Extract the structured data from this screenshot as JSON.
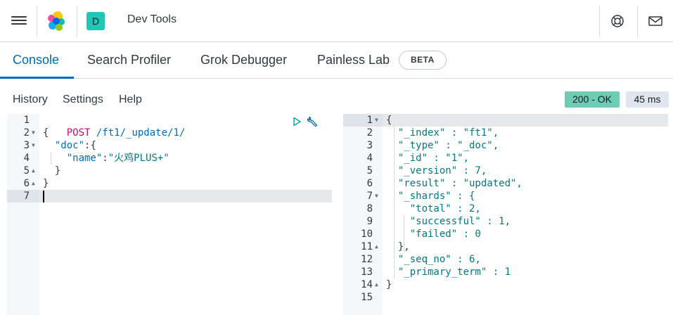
{
  "header": {
    "space_initial": "D",
    "title": "Dev Tools",
    "icons": [
      "menu-icon",
      "elastic-logo",
      "help-icon",
      "mail-icon"
    ]
  },
  "tabs": [
    {
      "label": "Console",
      "active": true
    },
    {
      "label": "Search Profiler",
      "active": false
    },
    {
      "label": "Grok Debugger",
      "active": false
    },
    {
      "label": "Painless Lab",
      "active": false
    }
  ],
  "beta_badge": "BETA",
  "toolbar": {
    "history": "History",
    "settings": "Settings",
    "help": "Help",
    "status": "200 - OK",
    "time": "45 ms"
  },
  "colors": {
    "accent": "#006bb8",
    "status_ok_bg": "#6dccb1",
    "teal_avatar": "#21c7b6"
  },
  "request": {
    "lines": [
      {
        "num": "1",
        "fold": "",
        "text": ""
      },
      {
        "num": "2",
        "fold": "down",
        "text": "{"
      },
      {
        "num": "3",
        "fold": "down",
        "text": "  \"doc\":{"
      },
      {
        "num": "4",
        "fold": "",
        "text": "    \"name\":\"火鸡PLUS+\""
      },
      {
        "num": "5",
        "fold": "up",
        "text": "  }"
      },
      {
        "num": "6",
        "fold": "up",
        "text": "}"
      },
      {
        "num": "7",
        "fold": "",
        "text": ""
      }
    ],
    "method": "POST",
    "url": "/ft1/_update/1/",
    "doc_key": "\"doc\"",
    "name_key": "\"name\"",
    "name_value": "\"火鸡PLUS+\""
  },
  "response": {
    "lines": [
      {
        "num": "1",
        "fold": "down",
        "text": "{"
      },
      {
        "num": "2",
        "fold": "",
        "text": "  \"_index\" : \"ft1\","
      },
      {
        "num": "3",
        "fold": "",
        "text": "  \"_type\" : \"_doc\","
      },
      {
        "num": "4",
        "fold": "",
        "text": "  \"_id\" : \"1\","
      },
      {
        "num": "5",
        "fold": "",
        "text": "  \"_version\" : 7,"
      },
      {
        "num": "6",
        "fold": "",
        "text": "  \"result\" : \"updated\","
      },
      {
        "num": "7",
        "fold": "down",
        "text": "  \"_shards\" : {"
      },
      {
        "num": "8",
        "fold": "",
        "text": "    \"total\" : 2,"
      },
      {
        "num": "9",
        "fold": "",
        "text": "    \"successful\" : 1,"
      },
      {
        "num": "10",
        "fold": "",
        "text": "    \"failed\" : 0"
      },
      {
        "num": "11",
        "fold": "up",
        "text": "  },"
      },
      {
        "num": "12",
        "fold": "",
        "text": "  \"_seq_no\" : 6,"
      },
      {
        "num": "13",
        "fold": "",
        "text": "  \"_primary_term\" : 1"
      },
      {
        "num": "14",
        "fold": "up",
        "text": "}"
      },
      {
        "num": "15",
        "fold": "",
        "text": ""
      }
    ]
  }
}
